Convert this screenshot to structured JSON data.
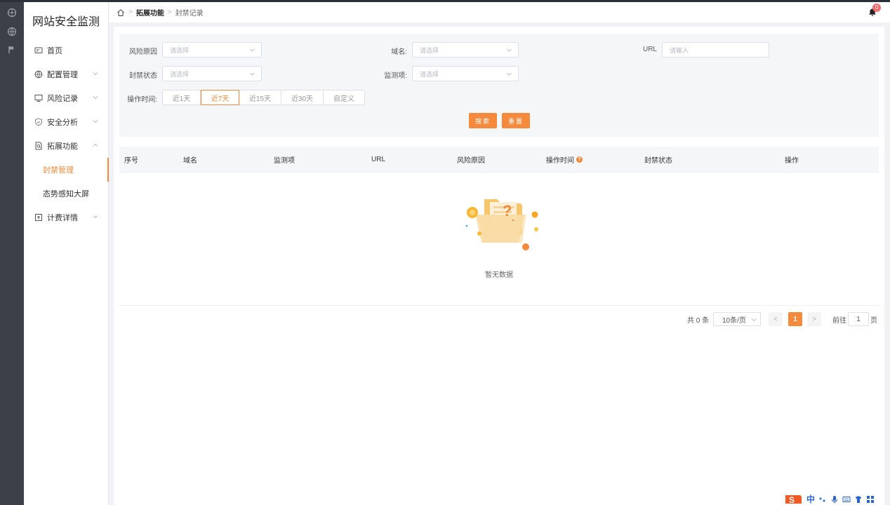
{
  "brand": "网站安全监测",
  "menu": {
    "home": "首页",
    "config": "配置管理",
    "risk": "风险记录",
    "analysis": "安全分析",
    "extend": "拓展功能",
    "sub_block": "封禁管理",
    "sub_screen": "态势感知大屏",
    "billing": "计费详情"
  },
  "breadcrumb": {
    "level1": "拓展功能",
    "level2": "封禁记录"
  },
  "notifications": {
    "count": "0"
  },
  "filters": {
    "risk_reason_label": "风险原因",
    "risk_reason_placeholder": "请选择",
    "domain_label": "域名:",
    "domain_placeholder": "请选择",
    "url_label": "URL",
    "url_placeholder": "请输入",
    "block_status_label": "封禁状态",
    "block_status_placeholder": "请选择",
    "monitor_label": "监测项:",
    "monitor_placeholder": "请选择",
    "time_label": "操作时间:",
    "time_options": [
      "近1天",
      "近7天",
      "近15天",
      "近30天",
      "自定义"
    ],
    "time_selected": "近7天",
    "search_button": "搜索",
    "reset_button": "重置"
  },
  "table": {
    "columns": [
      "序号",
      "域名",
      "监测项",
      "URL",
      "风险原因",
      "操作时间",
      "封禁状态",
      "操作"
    ],
    "rows": [],
    "empty_text": "暂无数据"
  },
  "pagination": {
    "total_text": "共 0 条",
    "page_size": "10条/页",
    "current_page": "1",
    "goto_label": "前往",
    "goto_value": "1",
    "page_unit": "页"
  },
  "ime": {
    "lang": "中"
  },
  "colors": {
    "accent": "#f58a3c",
    "rail": "#3c4049",
    "badge": "#f56c6c"
  }
}
